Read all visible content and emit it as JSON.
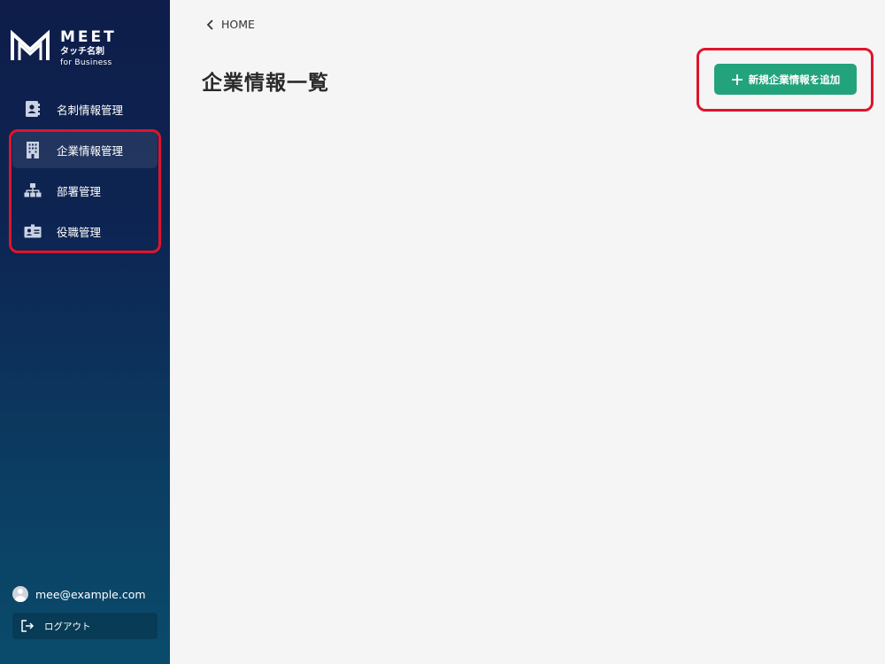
{
  "brand": {
    "name": "MEET",
    "subtitle": "タッチ名刺",
    "tagline": "for Business"
  },
  "sidebar": {
    "items": [
      {
        "label": "名刺情報管理",
        "icon": "contact-book-icon",
        "active": false
      },
      {
        "label": "企業情報管理",
        "icon": "building-icon",
        "active": true
      },
      {
        "label": "部署管理",
        "icon": "org-chart-icon",
        "active": false
      },
      {
        "label": "役職管理",
        "icon": "id-badge-icon",
        "active": false
      }
    ],
    "user_email": "mee@example.com",
    "logout_label": "ログアウト"
  },
  "main": {
    "breadcrumb": "HOME",
    "title": "企業情報一覧",
    "add_button_label": "新規企業情報を追加"
  },
  "colors": {
    "accent_green": "#22a37b",
    "highlight_red": "#e0142b",
    "sidebar_top": "#0e1d4a",
    "sidebar_bottom": "#0a4b6b"
  }
}
